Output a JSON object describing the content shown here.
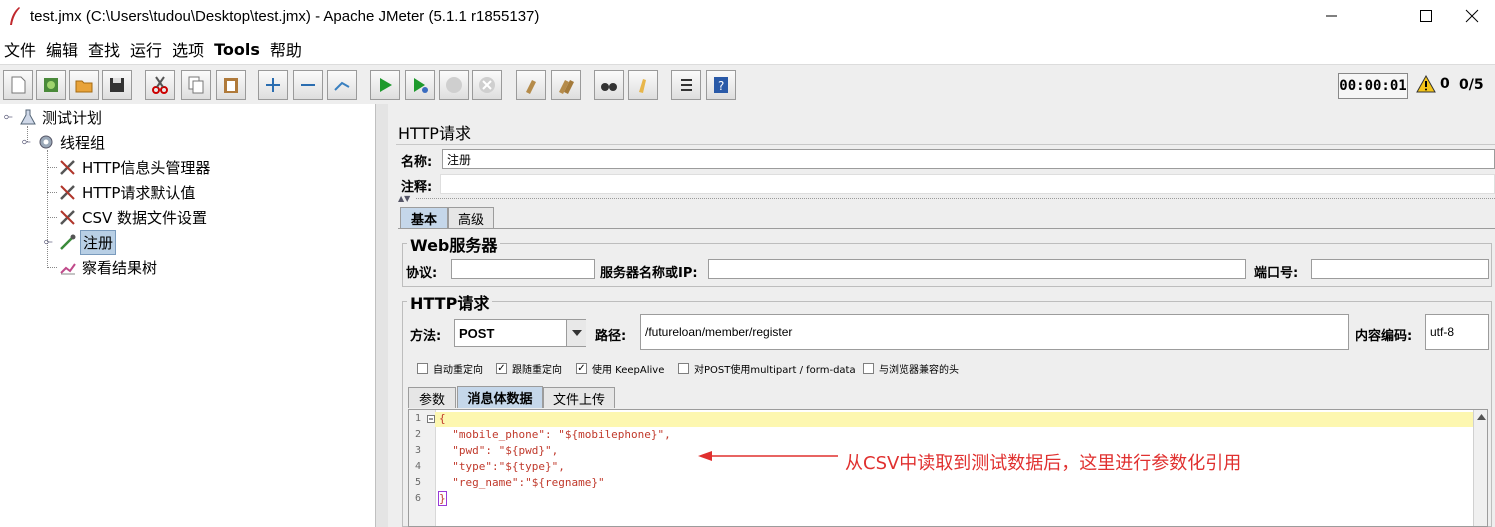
{
  "window": {
    "title": "test.jmx (C:\\Users\\tudou\\Desktop\\test.jmx) - Apache JMeter (5.1.1 r1855137)"
  },
  "menu": [
    "文件",
    "编辑",
    "查找",
    "运行",
    "选项",
    "Tools",
    "帮助"
  ],
  "status": {
    "timer": "00:00:01",
    "warnings": "0",
    "threads": "0/5"
  },
  "tree": {
    "root": "测试计划",
    "thread_group": "线程组",
    "children": [
      "HTTP信息头管理器",
      "HTTP请求默认值",
      "CSV 数据文件设置",
      "注册",
      "察看结果树"
    ]
  },
  "panel": {
    "title": "HTTP请求",
    "name_label": "名称:",
    "name_value": "注册",
    "comment_label": "注释:",
    "comment_value": "",
    "tabs": [
      "基本",
      "高级"
    ],
    "web_server": {
      "title": "Web服务器",
      "protocol_label": "协议:",
      "protocol_value": "",
      "server_label": "服务器名称或IP:",
      "server_value": "",
      "port_label": "端口号:",
      "port_value": ""
    },
    "http_request": {
      "title": "HTTP请求",
      "method_label": "方法:",
      "method_value": "POST",
      "path_label": "路径:",
      "path_value": "/futureloan/member/register",
      "encoding_label": "内容编码:",
      "encoding_value": "utf-8"
    },
    "options": [
      {
        "label": "自动重定向",
        "checked": false
      },
      {
        "label": "跟随重定向",
        "checked": true
      },
      {
        "label": "使用 KeepAlive",
        "checked": true
      },
      {
        "label": "对POST使用multipart / form-data",
        "checked": false
      },
      {
        "label": "与浏览器兼容的头",
        "checked": false
      }
    ],
    "sub_tabs": [
      "参数",
      "消息体数据",
      "文件上传"
    ],
    "body_lines": [
      "{",
      "  \"mobile_phone\": \"${mobilephone}\",",
      "  \"pwd\": \"${pwd}\",",
      "  \"type\":\"${type}\",",
      "  \"reg_name\":\"${regname}\"",
      "}"
    ],
    "line_numbers": [
      "1",
      "2",
      "3",
      "4",
      "5",
      "6"
    ]
  },
  "annotation": "从CSV中读取到测试数据后，这里进行参数化引用",
  "colors": {
    "selection": "#b8cfe5",
    "annotation": "#e0302f",
    "current_line": "#fdf7b0"
  }
}
